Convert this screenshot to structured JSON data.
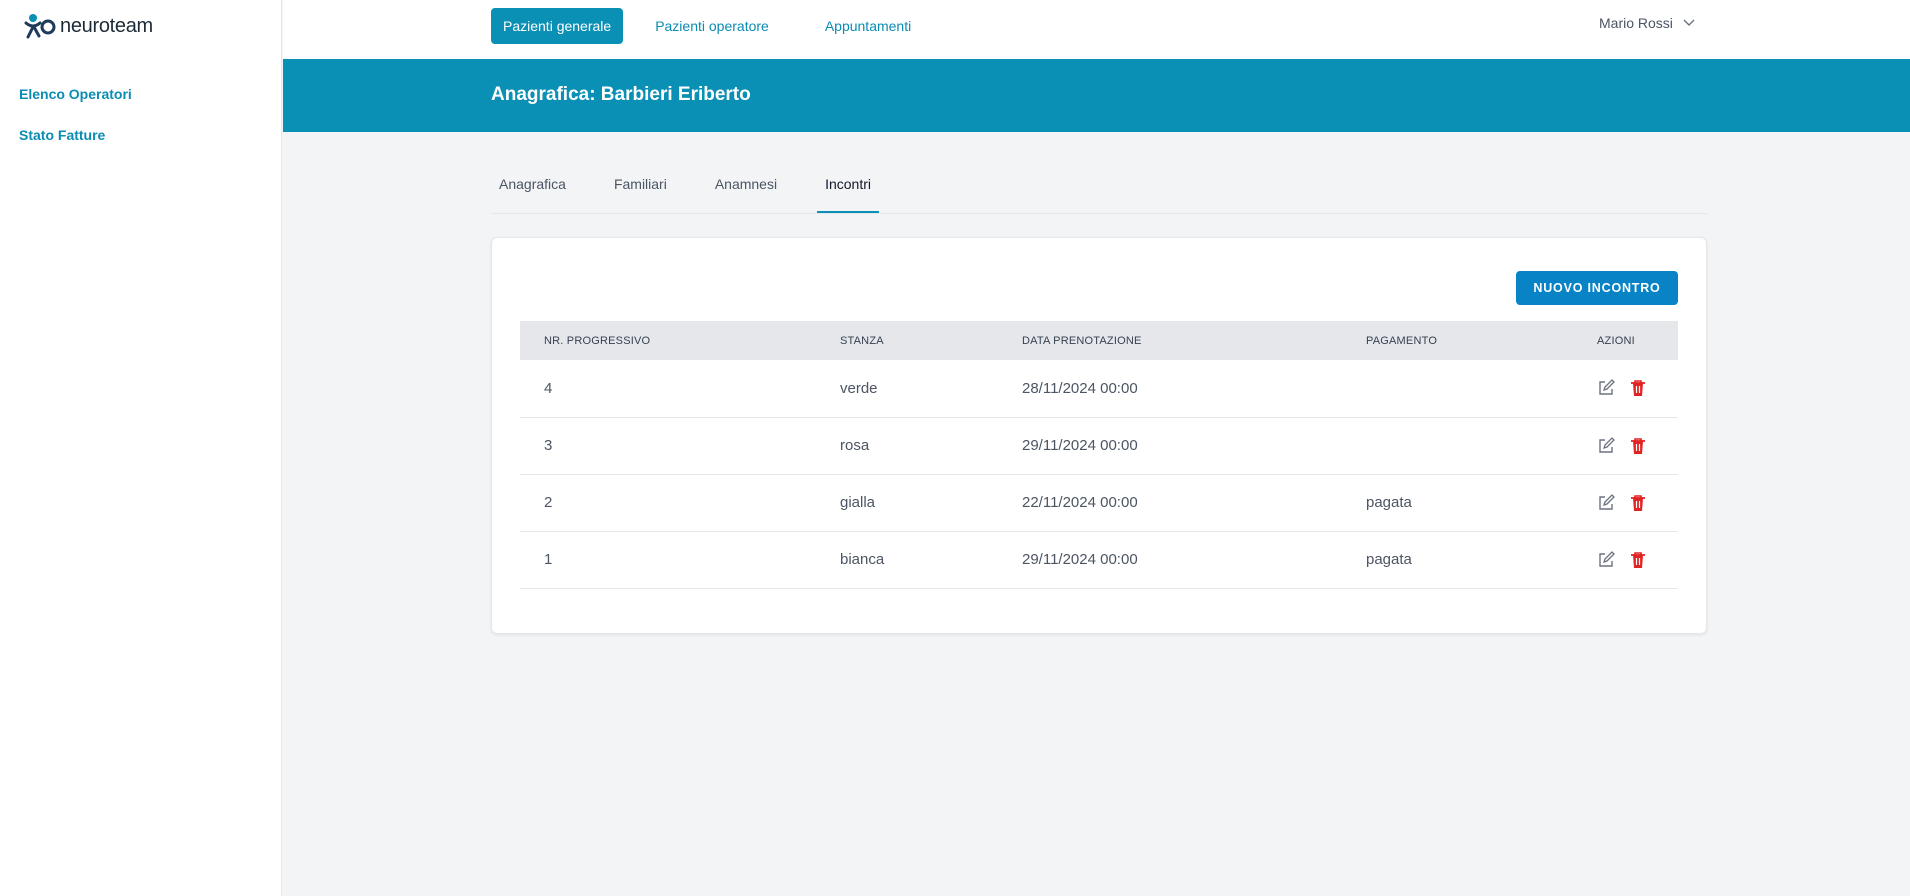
{
  "app": {
    "logo_text": "neuroteam"
  },
  "sidebar": {
    "items": [
      {
        "label": "Elenco Operatori"
      },
      {
        "label": "Stato Fatture"
      }
    ]
  },
  "topnav": {
    "items": [
      {
        "label": "Pazienti generale",
        "active": true
      },
      {
        "label": "Pazienti operatore",
        "active": false
      },
      {
        "label": "Appuntamenti",
        "active": false
      }
    ],
    "user": "Mario Rossi"
  },
  "header": {
    "title": "Anagrafica: Barbieri Eriberto"
  },
  "tabs": [
    {
      "label": "Anagrafica"
    },
    {
      "label": "Familiari"
    },
    {
      "label": "Anamnesi"
    },
    {
      "label": "Incontri",
      "active": true
    }
  ],
  "card": {
    "new_button": "NUOVO INCONTRO",
    "columns": [
      "NR. PROGRESSIVO",
      "STANZA",
      "DATA PRENOTAZIONE",
      "PAGAMENTO",
      "AZIONI"
    ],
    "rows": [
      {
        "nr": "4",
        "stanza": "verde",
        "data": "28/11/2024 00:00",
        "pagamento": ""
      },
      {
        "nr": "3",
        "stanza": "rosa",
        "data": "29/11/2024 00:00",
        "pagamento": ""
      },
      {
        "nr": "2",
        "stanza": "gialla",
        "data": "22/11/2024 00:00",
        "pagamento": "pagata"
      },
      {
        "nr": "1",
        "stanza": "bianca",
        "data": "29/11/2024 00:00",
        "pagamento": "pagata"
      }
    ]
  },
  "colors": {
    "primary": "#0a8fb5",
    "button": "#0883c6",
    "delete": "#e02424",
    "edit": "#6b7280"
  },
  "icons": {
    "edit": "edit-icon",
    "delete": "trash-icon",
    "user_menu": "chevron-down-icon",
    "logo": "logo-icon"
  }
}
